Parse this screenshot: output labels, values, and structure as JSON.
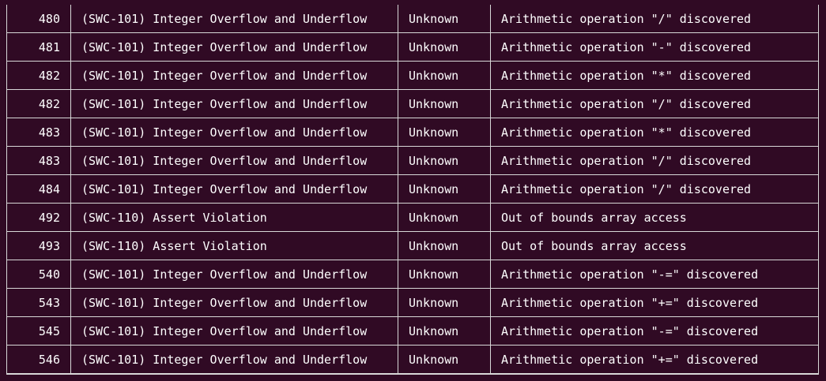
{
  "rows": [
    {
      "line": "480",
      "title": "(SWC-101) Integer Overflow and Underflow",
      "severity": "Unknown",
      "description": "Arithmetic operation \"/\" discovered"
    },
    {
      "line": "481",
      "title": "(SWC-101) Integer Overflow and Underflow",
      "severity": "Unknown",
      "description": "Arithmetic operation \"-\" discovered"
    },
    {
      "line": "482",
      "title": "(SWC-101) Integer Overflow and Underflow",
      "severity": "Unknown",
      "description": "Arithmetic operation \"*\" discovered"
    },
    {
      "line": "482",
      "title": "(SWC-101) Integer Overflow and Underflow",
      "severity": "Unknown",
      "description": "Arithmetic operation \"/\" discovered"
    },
    {
      "line": "483",
      "title": "(SWC-101) Integer Overflow and Underflow",
      "severity": "Unknown",
      "description": "Arithmetic operation \"*\" discovered"
    },
    {
      "line": "483",
      "title": "(SWC-101) Integer Overflow and Underflow",
      "severity": "Unknown",
      "description": "Arithmetic operation \"/\" discovered"
    },
    {
      "line": "484",
      "title": "(SWC-101) Integer Overflow and Underflow",
      "severity": "Unknown",
      "description": "Arithmetic operation \"/\" discovered"
    },
    {
      "line": "492",
      "title": "(SWC-110) Assert Violation",
      "severity": "Unknown",
      "description": "Out of bounds array access"
    },
    {
      "line": "493",
      "title": "(SWC-110) Assert Violation",
      "severity": "Unknown",
      "description": "Out of bounds array access"
    },
    {
      "line": "540",
      "title": "(SWC-101) Integer Overflow and Underflow",
      "severity": "Unknown",
      "description": "Arithmetic operation \"-=\" discovered"
    },
    {
      "line": "543",
      "title": "(SWC-101) Integer Overflow and Underflow",
      "severity": "Unknown",
      "description": "Arithmetic operation \"+=\" discovered"
    },
    {
      "line": "545",
      "title": "(SWC-101) Integer Overflow and Underflow",
      "severity": "Unknown",
      "description": "Arithmetic operation \"-=\" discovered"
    },
    {
      "line": "546",
      "title": "(SWC-101) Integer Overflow and Underflow",
      "severity": "Unknown",
      "description": "Arithmetic operation \"+=\" discovered"
    }
  ]
}
